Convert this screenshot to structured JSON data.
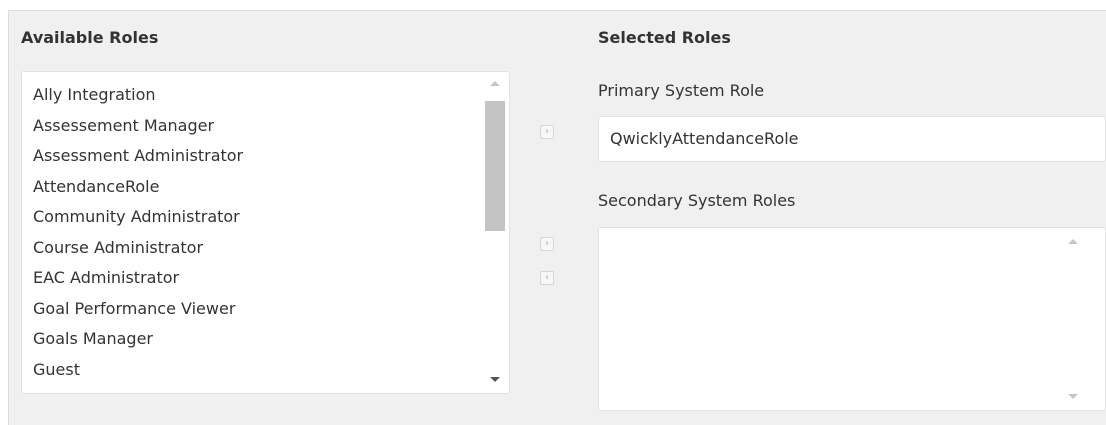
{
  "available": {
    "heading": "Available Roles",
    "items": [
      "Ally Integration",
      "Assessement Manager",
      "Assessment Administrator",
      "AttendanceRole",
      "Community Administrator",
      "Course Administrator",
      "EAC Administrator",
      "Goal Performance Viewer",
      "Goals Manager",
      "Guest"
    ]
  },
  "selected": {
    "heading": "Selected Roles",
    "primary_label": "Primary System Role",
    "primary_value": "QwicklyAttendanceRole",
    "secondary_label": "Secondary System Roles",
    "secondary_items": []
  },
  "controls": {
    "add_primary_glyph": "›",
    "add_secondary_glyph": "›",
    "remove_secondary_glyph": "‹"
  },
  "icons": {
    "scroll_up": "scroll-up-icon",
    "scroll_down": "scroll-down-icon",
    "move_right": "chevron-right-icon",
    "move_left": "chevron-left-icon"
  },
  "colors": {
    "panel_bg": "#f0f0f0",
    "field_bg": "#ffffff",
    "border": "#e2e2e2",
    "text": "#333333",
    "scroll_thumb": "#c4c4c4"
  }
}
